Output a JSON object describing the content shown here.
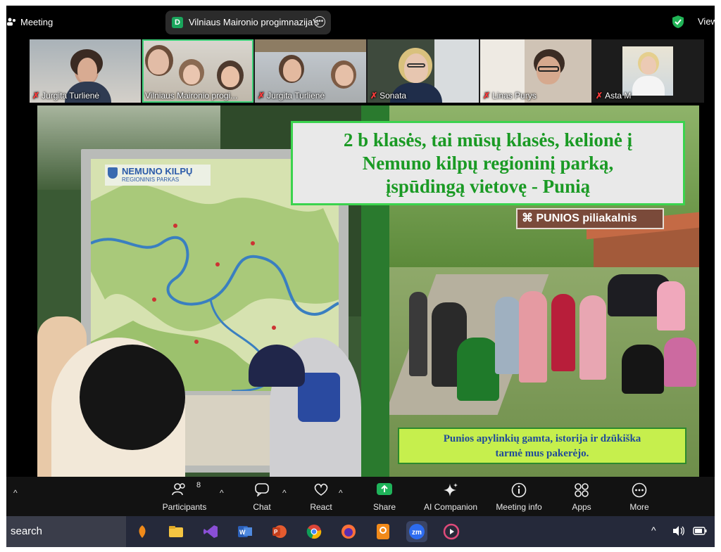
{
  "app": {
    "title": "Meeting",
    "view_label": "View"
  },
  "meeting_pill": {
    "badge": "D",
    "name": "Vilniaus Maironio progimnazija's"
  },
  "participants_strip": [
    {
      "name": "Jurgita Turlienė",
      "muted": true,
      "selected": false
    },
    {
      "name": "Vilniaus Maironio progi...",
      "muted": false,
      "selected": true
    },
    {
      "name": "Jurgita Turlienė",
      "muted": true,
      "selected": false
    },
    {
      "name": "Sonata",
      "muted": true,
      "selected": false
    },
    {
      "name": "Linas Purys",
      "muted": true,
      "selected": false
    },
    {
      "name": "Asta M",
      "muted": true,
      "selected": false
    }
  ],
  "shared_slide": {
    "title_line1": "2 b klasės, tai mūsų klasės,  kelionė į",
    "title_line2": "Nemuno kilpų regioninį parką,",
    "title_line3": "įspūdingą vietovę  - Punią",
    "caption_line1": "Punios apylinkių gamta, istorija ir dzūkiška",
    "caption_line2": "tarmė mus pakerėjo.",
    "sign_text": "⌘ PUNIOS piliakalnis",
    "map_title": "NEMUNO KILPŲ",
    "map_subtitle": "REGIONINIS PARKAS"
  },
  "toolbar": {
    "participants_label": "Participants",
    "participants_count": "8",
    "chat_label": "Chat",
    "react_label": "React",
    "share_label": "Share",
    "ai_label": "AI Companion",
    "info_label": "Meeting info",
    "apps_label": "Apps",
    "more_label": "More",
    "share_color": "#1fb35a"
  },
  "taskbar": {
    "search_label": "search",
    "zoom_label": "zm"
  }
}
